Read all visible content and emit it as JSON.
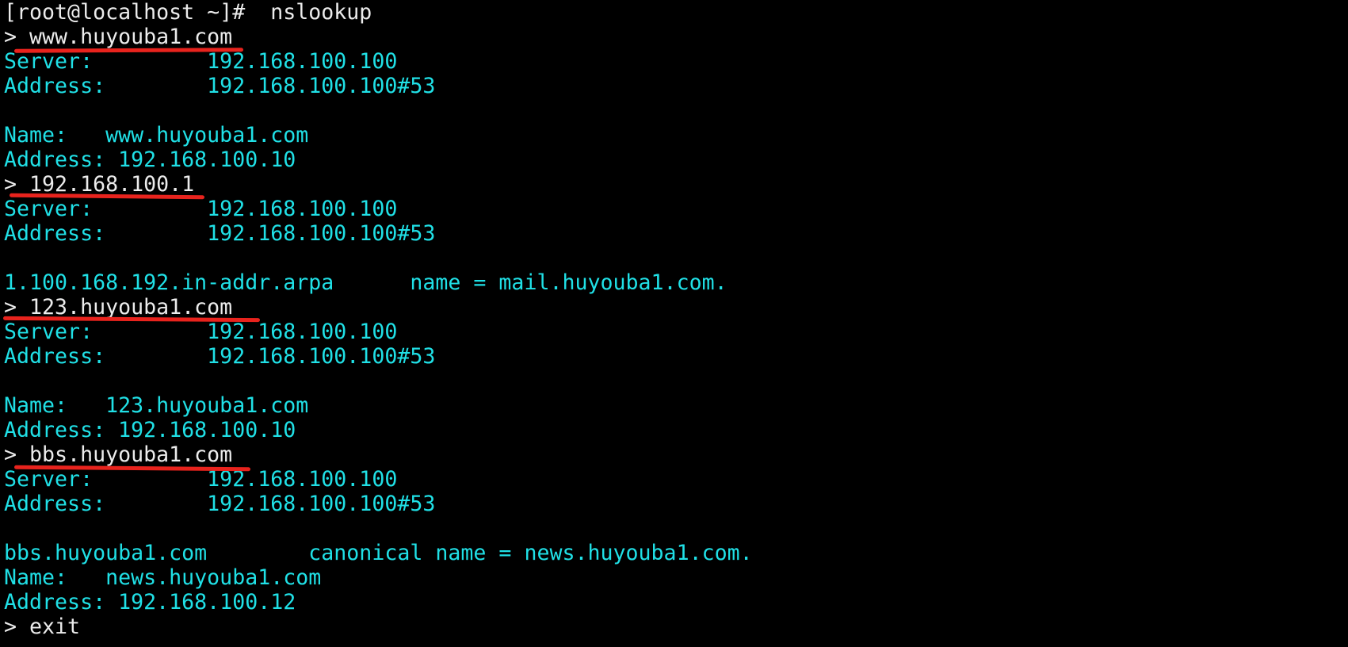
{
  "theme": {
    "background": "#000000",
    "text_color": "#20e0e6",
    "prompt_color": "#ececec",
    "annotation_color": "#e8231d"
  },
  "lines": [
    "[root@localhost ~]#  nslookup",
    "> www.huyouba1.com",
    "Server:         192.168.100.100",
    "Address:        192.168.100.100#53",
    "",
    "Name:   www.huyouba1.com",
    "Address: 192.168.100.10",
    "> 192.168.100.1",
    "Server:         192.168.100.100",
    "Address:        192.168.100.100#53",
    "",
    "1.100.168.192.in-addr.arpa      name = mail.huyouba1.com.",
    "> 123.huyouba1.com",
    "Server:         192.168.100.100",
    "Address:        192.168.100.100#53",
    "",
    "Name:   123.huyouba1.com",
    "Address: 192.168.100.10",
    "> bbs.huyouba1.com",
    "Server:         192.168.100.100",
    "Address:        192.168.100.100#53",
    "",
    "bbs.huyouba1.com        canonical name = news.huyouba1.com.",
    "Name:   news.huyouba1.com",
    "Address: 192.168.100.12",
    "> exit"
  ]
}
